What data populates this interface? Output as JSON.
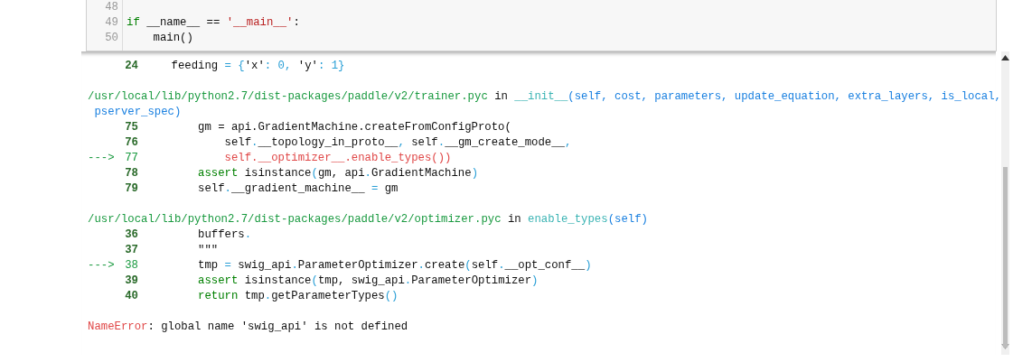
{
  "input_cell": {
    "lines": [
      {
        "number": "48"
      },
      {
        "number": "49",
        "segments": [
          {
            "kind": "keyword",
            "text": "if"
          },
          {
            "kind": "plain",
            "text": " __name__ == "
          },
          {
            "kind": "string",
            "text": "'__main__'"
          },
          {
            "kind": "plain",
            "text": ":"
          }
        ]
      },
      {
        "number": "50",
        "segments": [
          {
            "kind": "plain",
            "text": "    main()"
          }
        ]
      }
    ]
  },
  "traceback": [
    {
      "kind": "frame_line",
      "number": "24",
      "current": false,
      "segments": [
        {
          "kind": "plain",
          "text": "    feeding "
        },
        {
          "kind": "op",
          "text": "= {"
        },
        {
          "kind": "plain",
          "text": "'x'"
        },
        {
          "kind": "op",
          "text": ": 0, "
        },
        {
          "kind": "plain",
          "text": "'y'"
        },
        {
          "kind": "op",
          "text": ": 1}"
        }
      ]
    },
    {
      "kind": "blank"
    },
    {
      "kind": "header",
      "segments": [
        {
          "kind": "path",
          "text": "/usr/local/lib/python2.7/dist-packages/paddle/v2/trainer.pyc"
        },
        {
          "kind": "plain",
          "text": " in "
        },
        {
          "kind": "func",
          "text": "__init__"
        },
        {
          "kind": "arg",
          "text": "(self, cost, parameters, update_equation, extra_layers, is_local,"
        }
      ]
    },
    {
      "kind": "header",
      "segments": [
        {
          "kind": "arg",
          "text": " pserver_spec)"
        }
      ]
    },
    {
      "kind": "frame_line",
      "number": "75",
      "current": false,
      "segments": [
        {
          "kind": "plain",
          "text": "        gm = api.GradientMachine.createFromConfigProto("
        }
      ]
    },
    {
      "kind": "frame_line",
      "number": "76",
      "current": false,
      "segments": [
        {
          "kind": "plain",
          "text": "            self"
        },
        {
          "kind": "op",
          "text": "."
        },
        {
          "kind": "plain",
          "text": "__topology_in_proto__"
        },
        {
          "kind": "op",
          "text": ","
        },
        {
          "kind": "plain",
          "text": " self"
        },
        {
          "kind": "op",
          "text": "."
        },
        {
          "kind": "plain",
          "text": "__gm_create_mode__"
        },
        {
          "kind": "op",
          "text": ","
        }
      ]
    },
    {
      "kind": "frame_line",
      "number": "77",
      "current": true,
      "marker": "--->",
      "segments": [
        {
          "kind": "highlight",
          "text": "            self.__optimizer__.enable_types())"
        }
      ]
    },
    {
      "kind": "frame_line",
      "number": "78",
      "current": false,
      "segments": [
        {
          "kind": "keyword",
          "text": "        assert"
        },
        {
          "kind": "plain",
          "text": " isinstance"
        },
        {
          "kind": "op",
          "text": "("
        },
        {
          "kind": "plain",
          "text": "gm, api"
        },
        {
          "kind": "op",
          "text": "."
        },
        {
          "kind": "plain",
          "text": "GradientMachine"
        },
        {
          "kind": "op",
          "text": ")"
        }
      ]
    },
    {
      "kind": "frame_line",
      "number": "79",
      "current": false,
      "segments": [
        {
          "kind": "plain",
          "text": "        self"
        },
        {
          "kind": "op",
          "text": "."
        },
        {
          "kind": "plain",
          "text": "__gradient_machine__ "
        },
        {
          "kind": "op",
          "text": "="
        },
        {
          "kind": "plain",
          "text": " gm"
        }
      ]
    },
    {
      "kind": "blank"
    },
    {
      "kind": "header",
      "segments": [
        {
          "kind": "path",
          "text": "/usr/local/lib/python2.7/dist-packages/paddle/v2/optimizer.pyc"
        },
        {
          "kind": "plain",
          "text": " in "
        },
        {
          "kind": "func",
          "text": "enable_types"
        },
        {
          "kind": "arg",
          "text": "(self)"
        }
      ]
    },
    {
      "kind": "frame_line",
      "number": "36",
      "current": false,
      "segments": [
        {
          "kind": "plain",
          "text": "        buffers"
        },
        {
          "kind": "op",
          "text": "."
        }
      ]
    },
    {
      "kind": "frame_line",
      "number": "37",
      "current": false,
      "segments": [
        {
          "kind": "plain",
          "text": "        \"\"\""
        }
      ]
    },
    {
      "kind": "frame_line",
      "number": "38",
      "current": true,
      "marker": "--->",
      "segments": [
        {
          "kind": "plain",
          "text": "        tmp "
        },
        {
          "kind": "op",
          "text": "="
        },
        {
          "kind": "plain",
          "text": " swig_api"
        },
        {
          "kind": "op",
          "text": "."
        },
        {
          "kind": "plain",
          "text": "ParameterOptimizer"
        },
        {
          "kind": "op",
          "text": "."
        },
        {
          "kind": "plain",
          "text": "create"
        },
        {
          "kind": "op",
          "text": "("
        },
        {
          "kind": "plain",
          "text": "self"
        },
        {
          "kind": "op",
          "text": "."
        },
        {
          "kind": "plain",
          "text": "__opt_conf__"
        },
        {
          "kind": "op",
          "text": ")"
        }
      ]
    },
    {
      "kind": "frame_line",
      "number": "39",
      "current": false,
      "segments": [
        {
          "kind": "keyword",
          "text": "        assert"
        },
        {
          "kind": "plain",
          "text": " isinstance"
        },
        {
          "kind": "op",
          "text": "("
        },
        {
          "kind": "plain",
          "text": "tmp, swig_api"
        },
        {
          "kind": "op",
          "text": "."
        },
        {
          "kind": "plain",
          "text": "ParameterOptimizer"
        },
        {
          "kind": "op",
          "text": ")"
        }
      ]
    },
    {
      "kind": "frame_line",
      "number": "40",
      "current": false,
      "segments": [
        {
          "kind": "keyword",
          "text": "        return"
        },
        {
          "kind": "plain",
          "text": " tmp"
        },
        {
          "kind": "op",
          "text": "."
        },
        {
          "kind": "plain",
          "text": "getParameterTypes"
        },
        {
          "kind": "op",
          "text": "()"
        }
      ]
    },
    {
      "kind": "blank"
    },
    {
      "kind": "error",
      "segments": [
        {
          "kind": "error",
          "text": "NameError"
        },
        {
          "kind": "plain",
          "text": ": global name 'swig_api' is not defined"
        }
      ]
    }
  ]
}
